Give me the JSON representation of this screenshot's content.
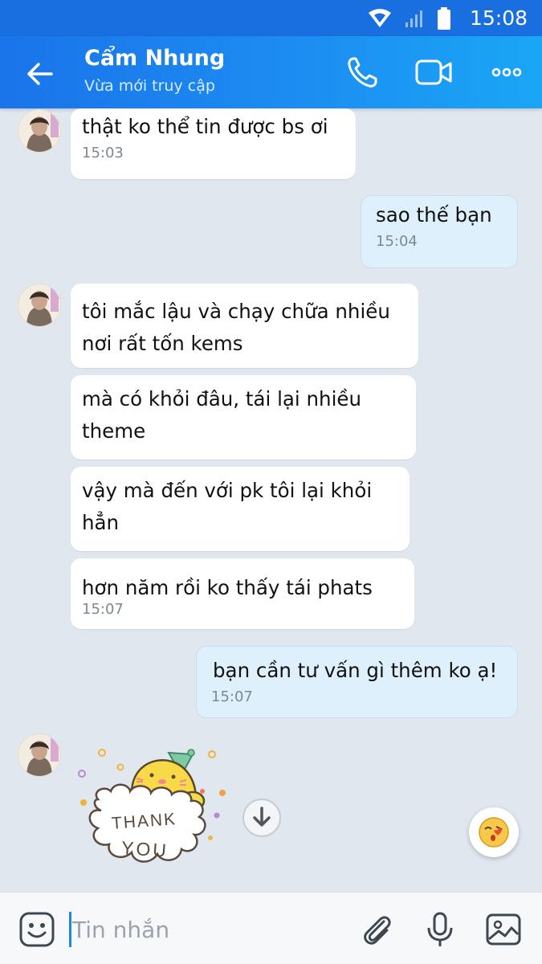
{
  "status_bar": {
    "time": "15:08"
  },
  "header": {
    "contact_name": "Cẩm Nhung",
    "contact_status": "Vừa mới truy cập",
    "icons": [
      "back-arrow-icon",
      "phone-icon",
      "video-call-icon",
      "more-icon"
    ]
  },
  "messages": [
    {
      "direction": "in",
      "text": "thật ko thể tin được bs ơi",
      "time": "15:03"
    },
    {
      "direction": "out",
      "text": "sao thế bạn",
      "time": "15:04"
    },
    {
      "direction": "in",
      "text": "tôi mắc lậu và chạy chữa nhiều\nnơi rất tốn kems"
    },
    {
      "direction": "in",
      "text": "mà có khỏi đâu, tái lại nhiều\ntheme"
    },
    {
      "direction": "in",
      "text": "vậy mà đến với pk tôi lại khỏi\nhẳn"
    },
    {
      "direction": "in",
      "text": "hơn năm rồi ko thấy tái phats",
      "time": "15:07"
    },
    {
      "direction": "out",
      "text": "bạn cần tư vấn gì thêm ko ạ!",
      "time": "15:07"
    }
  ],
  "sticker": {
    "line1": "THANK",
    "line2": "YOU"
  },
  "composer": {
    "placeholder": "Tin nhắn",
    "icons": [
      "sticker-icon",
      "attachment-icon",
      "microphone-icon",
      "image-icon"
    ]
  },
  "colors": {
    "header_start": "#1a74ea",
    "header_end": "#1aa6f5",
    "outgoing_bubble": "#dff0fd",
    "incoming_bubble": "#ffffff",
    "chat_background": "#e1e7ef"
  }
}
